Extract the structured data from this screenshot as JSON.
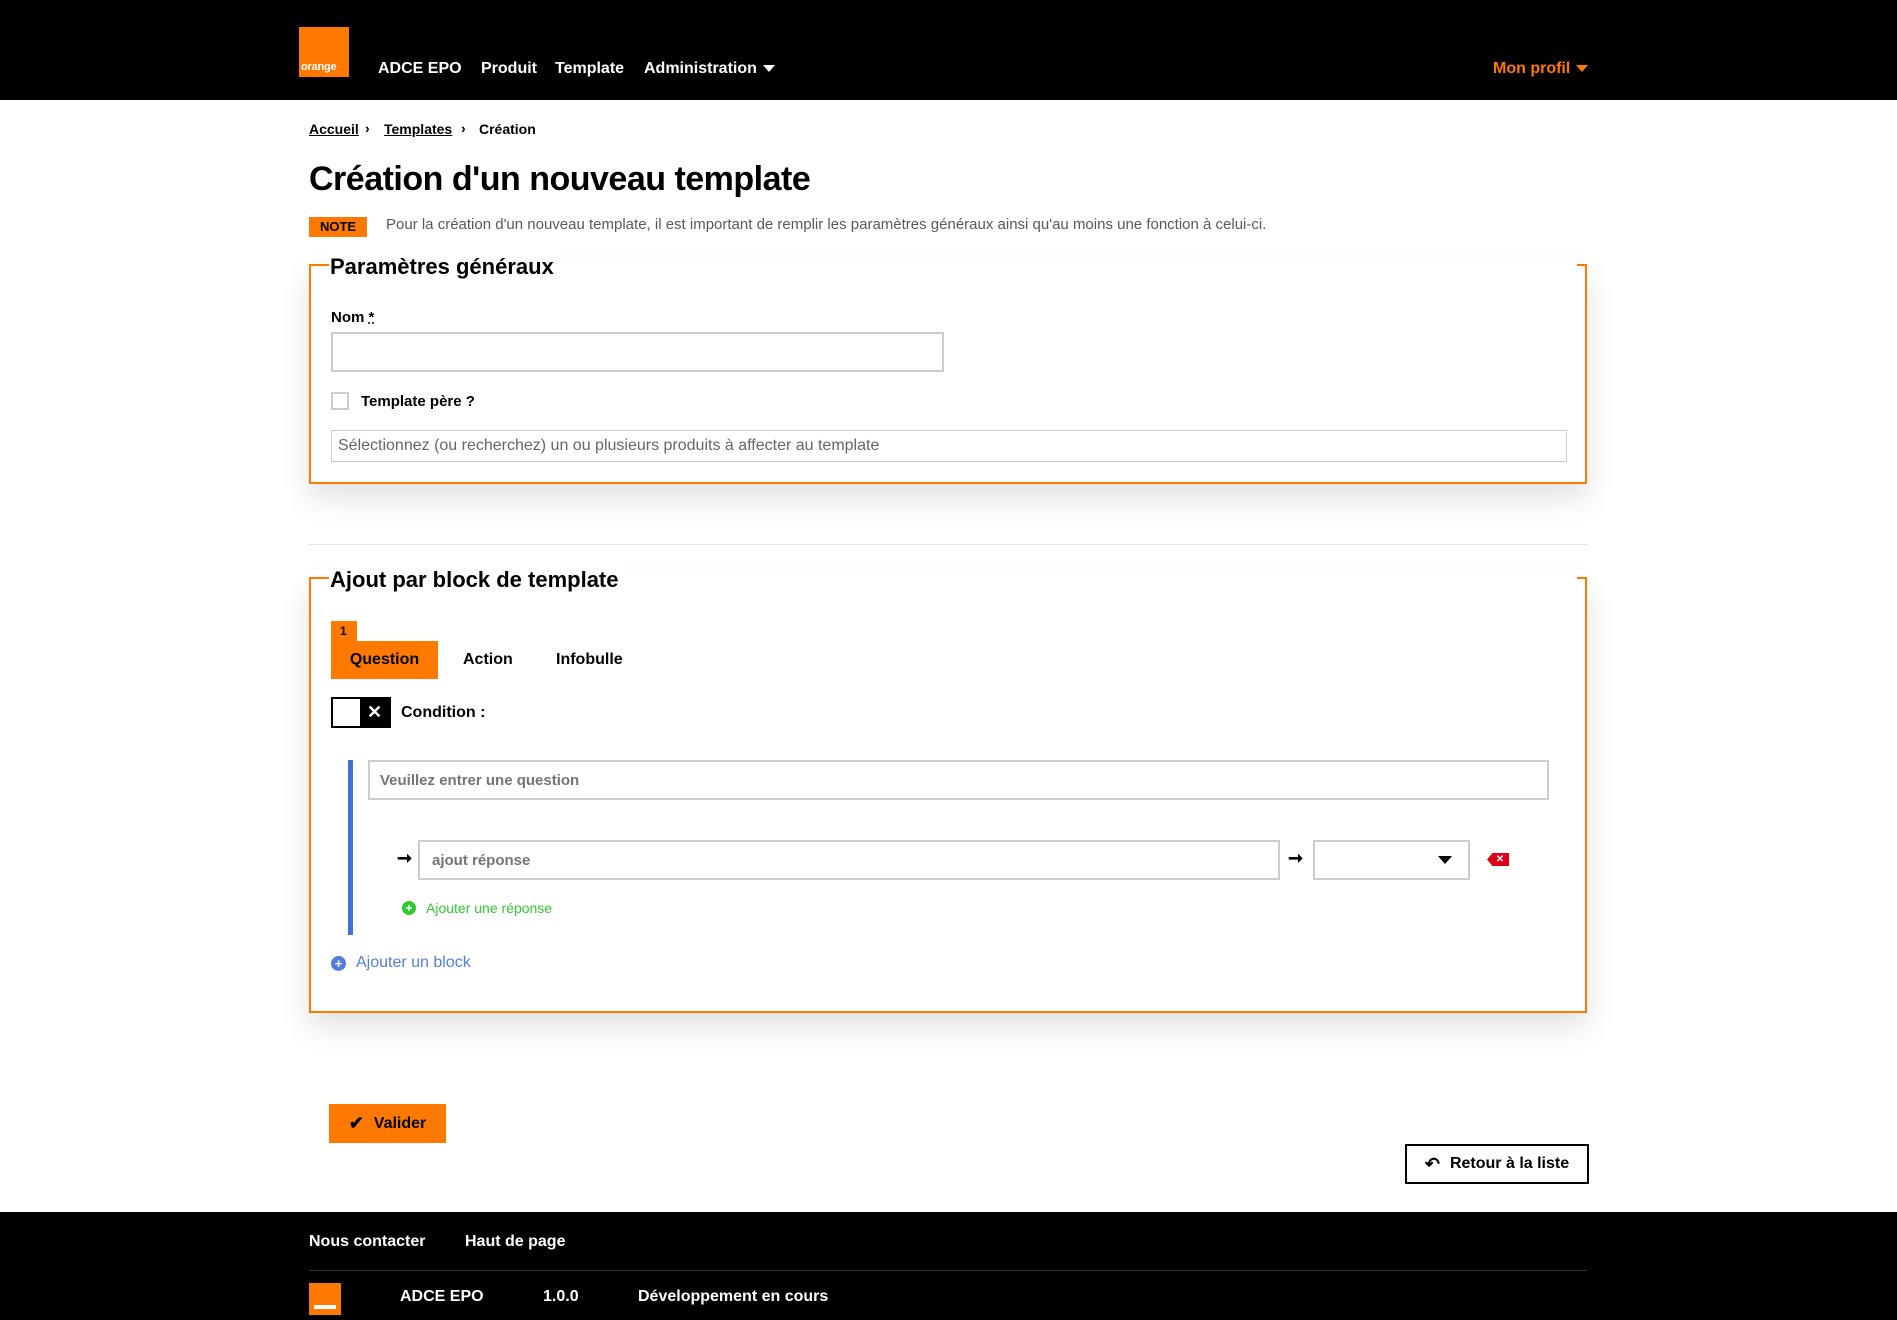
{
  "header": {
    "logo_text": "orange",
    "nav": [
      {
        "label": "ADCE EPO"
      },
      {
        "label": "Produit"
      },
      {
        "label": "Template"
      },
      {
        "label": "Administration"
      }
    ],
    "profile_label": "Mon profil"
  },
  "breadcrumb": [
    "Accueil",
    "Templates",
    "Création"
  ],
  "page_title": "Création d'un nouveau template",
  "note": {
    "badge": "NOTE",
    "text": "Pour la création d'un nouveau template, il est important de remplir les paramètres généraux ainsi qu'au moins une fonction à celui-ci."
  },
  "general": {
    "legend": "Paramètres généraux",
    "name_label": "Nom",
    "required_mark": "*",
    "name_value": "",
    "parent_label": "Template père ?",
    "parent_checked": false,
    "products_placeholder": "Sélectionnez (ou recherchez) un ou plusieurs produits à affecter au template"
  },
  "blocks": {
    "legend": "Ajout par block de template",
    "tab_number": "1",
    "tabs": [
      "Question",
      "Action",
      "Infobulle"
    ],
    "active_tab": "Question",
    "condition_label": "Condition :",
    "condition_on": false,
    "question_placeholder": "Veuillez entrer une question",
    "answer_placeholder": "ajout réponse",
    "select_value": "",
    "add_answer_label": "Ajouter une réponse",
    "add_block_label": "Ajouter un block"
  },
  "actions": {
    "validate_label": "Valider",
    "back_label": "Retour à la liste"
  },
  "footer": {
    "links": [
      "Nous contacter",
      "Haut de page"
    ],
    "app_name": "ADCE EPO",
    "version": "1.0.0",
    "status": "Développement en cours"
  },
  "colors": {
    "accent": "#ff7900",
    "success": "#32c832",
    "info": "#527edb",
    "danger": "#e0001a",
    "bar": "#4170d6"
  }
}
